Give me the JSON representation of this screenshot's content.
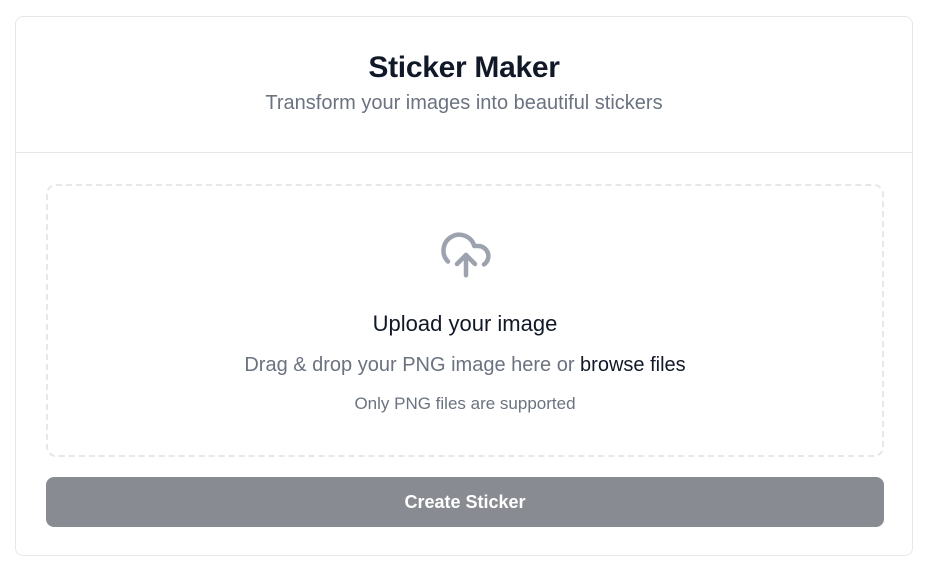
{
  "header": {
    "title": "Sticker Maker",
    "subtitle": "Transform your images into beautiful stickers"
  },
  "upload": {
    "icon": "cloud-upload-icon",
    "title": "Upload your image",
    "description_prefix": "Drag & drop your PNG image here or ",
    "browse_label": "browse files",
    "note": "Only PNG files are supported"
  },
  "actions": {
    "create_label": "Create Sticker"
  },
  "colors": {
    "title": "#111827",
    "muted_text": "#6b7280",
    "border": "#e5e7eb",
    "icon": "#9ca3af",
    "button_disabled": "#898b92",
    "button_text": "#ffffff"
  }
}
